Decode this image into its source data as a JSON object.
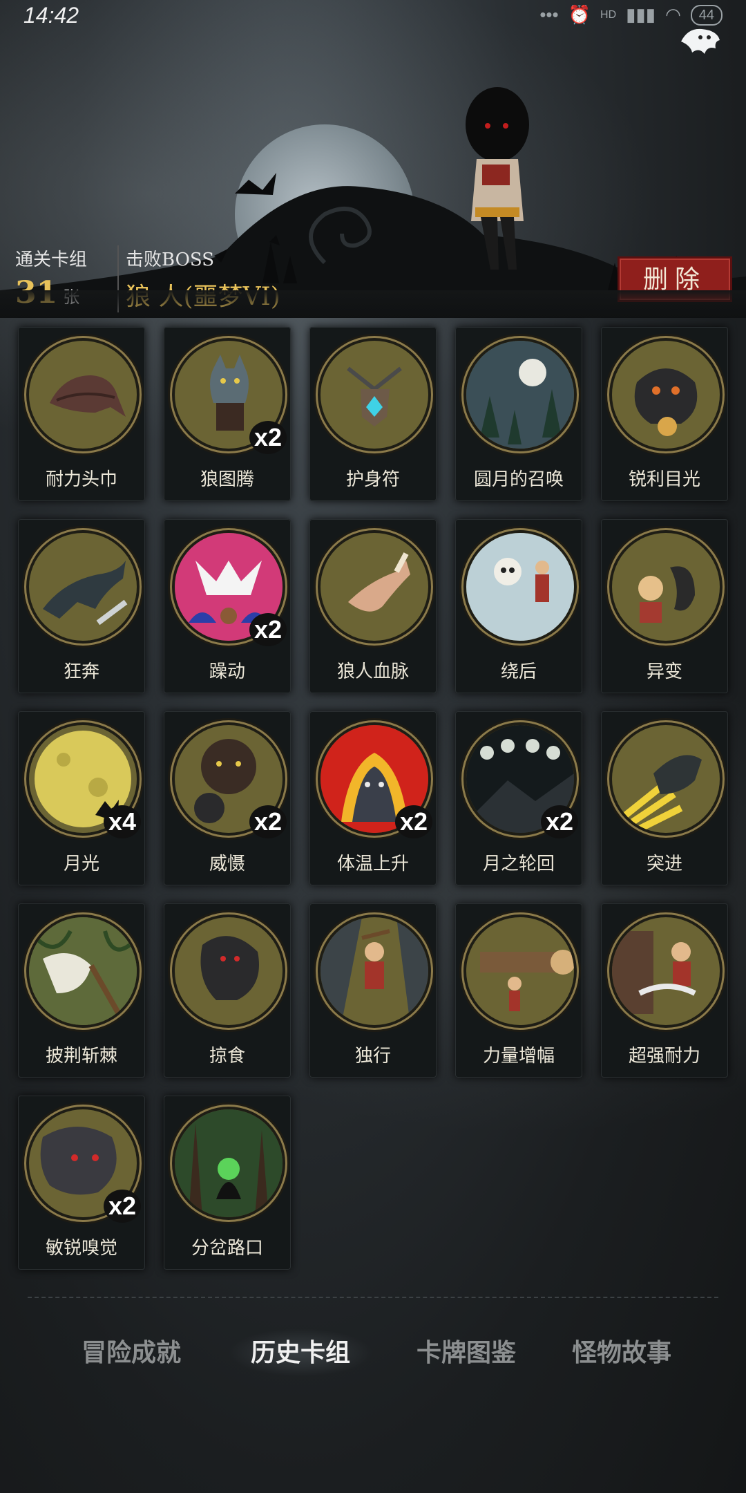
{
  "status": {
    "time": "14:42",
    "battery": "44",
    "network": "HD"
  },
  "header": {
    "deck_label": "通关卡组",
    "deck_count": "31",
    "deck_unit": "张",
    "boss_label": "击败BOSS",
    "boss_name": "狼 人(噩梦VI)",
    "delete_label": "删除"
  },
  "cards": [
    {
      "name": "耐力头巾",
      "multiplier": "",
      "icon": "bandana-icon"
    },
    {
      "name": "狼图腾",
      "multiplier": "x2",
      "icon": "wolf-totem-icon"
    },
    {
      "name": "护身符",
      "multiplier": "",
      "icon": "amulet-icon"
    },
    {
      "name": "圆月的召唤",
      "multiplier": "",
      "icon": "full-moon-icon"
    },
    {
      "name": "锐利目光",
      "multiplier": "",
      "icon": "werewolf-eyes-icon"
    },
    {
      "name": "狂奔",
      "multiplier": "",
      "icon": "running-wolf-icon"
    },
    {
      "name": "躁动",
      "multiplier": "x2",
      "icon": "frenzy-icon"
    },
    {
      "name": "狼人血脉",
      "multiplier": "",
      "icon": "claw-arm-icon"
    },
    {
      "name": "绕后",
      "multiplier": "",
      "icon": "skeleton-ambush-icon"
    },
    {
      "name": "异变",
      "multiplier": "",
      "icon": "mutation-icon"
    },
    {
      "name": "月光",
      "multiplier": "x4",
      "icon": "moonlight-icon"
    },
    {
      "name": "威慑",
      "multiplier": "x2",
      "icon": "bear-icon"
    },
    {
      "name": "体温上升",
      "multiplier": "x2",
      "icon": "fire-wolf-icon"
    },
    {
      "name": "月之轮回",
      "multiplier": "x2",
      "icon": "moon-phases-icon"
    },
    {
      "name": "突进",
      "multiplier": "",
      "icon": "dash-wolf-icon"
    },
    {
      "name": "披荆斩棘",
      "multiplier": "",
      "icon": "axe-thorns-icon"
    },
    {
      "name": "掠食",
      "multiplier": "",
      "icon": "predator-icon"
    },
    {
      "name": "独行",
      "multiplier": "",
      "icon": "lone-hero-icon"
    },
    {
      "name": "力量增幅",
      "multiplier": "",
      "icon": "log-lift-icon"
    },
    {
      "name": "超强耐力",
      "multiplier": "",
      "icon": "woodcutter-icon"
    },
    {
      "name": "敏锐嗅觉",
      "multiplier": "x2",
      "icon": "sniffing-wolf-icon"
    },
    {
      "name": "分岔路口",
      "multiplier": "",
      "icon": "forest-path-icon"
    }
  ],
  "tabs": [
    {
      "label": "冒险成就",
      "active": false
    },
    {
      "label": "历史卡组",
      "active": true
    },
    {
      "label": "卡牌图鉴",
      "active": false
    },
    {
      "label": "怪物故事",
      "active": false
    }
  ],
  "colors": {
    "accent_gold": "#e8c25a",
    "delete_red": "#8f1f1c",
    "card_bg": "#141819"
  }
}
